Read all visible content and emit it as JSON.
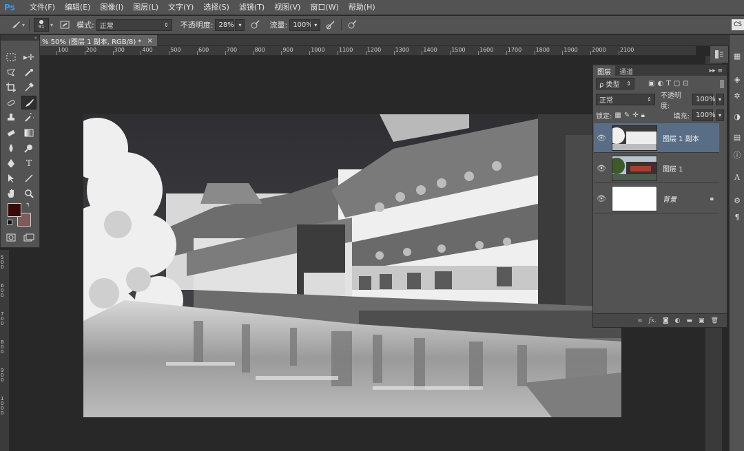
{
  "app": {
    "logo": "Ps"
  },
  "menu": [
    "文件(F)",
    "编辑(E)",
    "图像(I)",
    "图层(L)",
    "文字(Y)",
    "选择(S)",
    "滤镜(T)",
    "视图(V)",
    "窗口(W)",
    "帮助(H)"
  ],
  "options": {
    "brush_size": "91",
    "mode_label": "模式:",
    "mode_value": "正常",
    "opacity_label": "不透明度:",
    "opacity_value": "28%",
    "flow_label": "流量:",
    "flow_value": "100%",
    "workspace_btn": "CS"
  },
  "document": {
    "tab_title": "% 50% (图层 1 副本, RGB/8) *",
    "close": "×"
  },
  "ruler_h": [
    "100",
    "200",
    "300",
    "400",
    "500",
    "600",
    "700",
    "800",
    "900",
    "1000",
    "1100",
    "1200",
    "1300",
    "1400",
    "1500",
    "1600",
    "1700",
    "1800",
    "1900",
    "2000",
    "2100"
  ],
  "ruler_v": [
    "500",
    "600",
    "700",
    "800",
    "900",
    "1000"
  ],
  "layers_panel": {
    "tabs": [
      "图层",
      "通道"
    ],
    "filter_label": "ρ 类型",
    "blend_mode": "正常",
    "opacity_label": "不透明度:",
    "opacity_value": "100%",
    "lock_label": "锁定:",
    "fill_label": "填充:",
    "fill_value": "100%",
    "layers": [
      {
        "name": "图层 1 副本",
        "selected": true
      },
      {
        "name": "图层 1",
        "selected": false
      },
      {
        "name": "背景",
        "selected": false
      }
    ]
  },
  "colors": {
    "foreground": "#3a0a0a",
    "background": "#7e5a5a",
    "selection": "#596d87",
    "panel": "#535353",
    "workspace": "#282828"
  }
}
